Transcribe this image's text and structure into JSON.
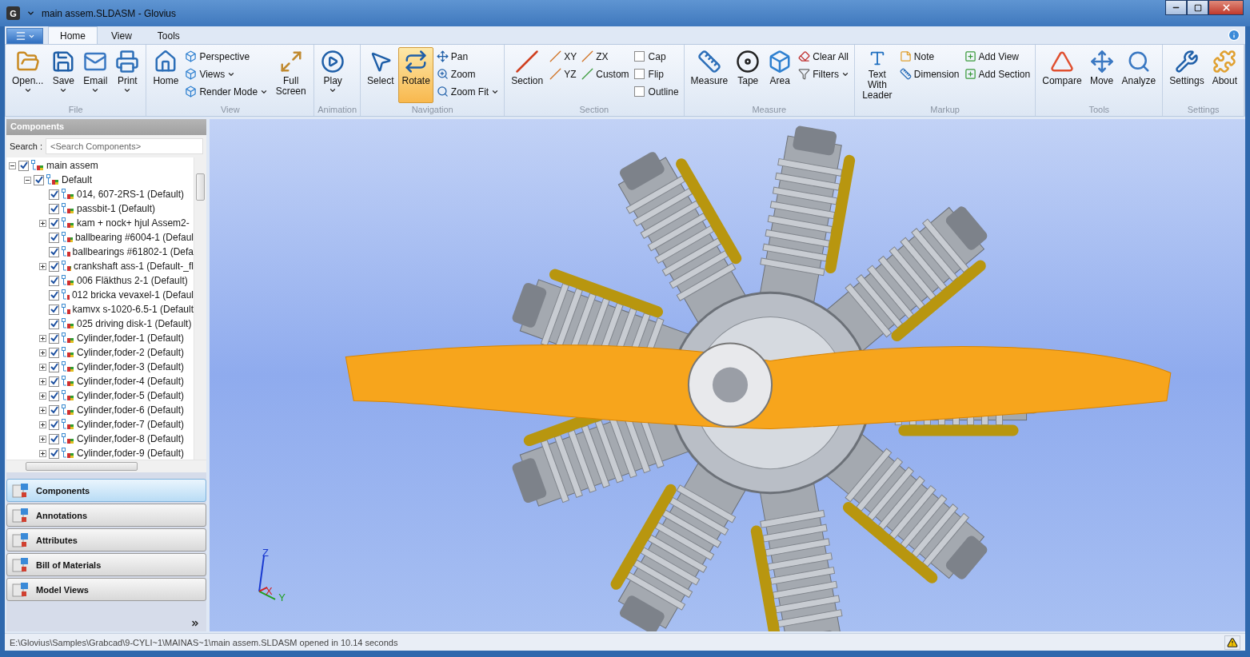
{
  "window": {
    "app_icon_letter": "G",
    "title": "main assem.SLDASM - Glovius"
  },
  "tabs": [
    {
      "label": "Home",
      "selected": true
    },
    {
      "label": "View",
      "selected": false
    },
    {
      "label": "Tools",
      "selected": false
    }
  ],
  "ribbon": [
    {
      "label": "File",
      "items": [
        {
          "kind": "large",
          "label": "Open...",
          "dropdown": true
        },
        {
          "kind": "large",
          "label": "Save",
          "dropdown": true
        },
        {
          "kind": "large",
          "label": "Email",
          "dropdown": true
        },
        {
          "kind": "large",
          "label": "Print",
          "dropdown": true
        }
      ]
    },
    {
      "label": "View",
      "items": [
        {
          "kind": "large",
          "label": "Home"
        },
        {
          "kind": "stack",
          "items": [
            {
              "kind": "small",
              "label": "Perspective"
            },
            {
              "kind": "small",
              "label": "Views",
              "dropdown": true
            },
            {
              "kind": "small",
              "label": "Render Mode",
              "dropdown": true
            }
          ]
        },
        {
          "kind": "large",
          "label": "Full Screen"
        }
      ]
    },
    {
      "label": "Animation",
      "items": [
        {
          "kind": "large",
          "label": "Play",
          "dropdown": true
        }
      ]
    },
    {
      "label": "Navigation",
      "items": [
        {
          "kind": "large",
          "label": "Select",
          "selected": false
        },
        {
          "kind": "large",
          "label": "Rotate",
          "selected": true
        },
        {
          "kind": "stack",
          "items": [
            {
              "kind": "small",
              "label": "Pan"
            },
            {
              "kind": "small",
              "label": "Zoom"
            },
            {
              "kind": "small",
              "label": "Zoom Fit",
              "dropdown": true
            }
          ]
        }
      ]
    },
    {
      "label": "Section",
      "items": [
        {
          "kind": "large",
          "label": "Section"
        },
        {
          "kind": "stack",
          "items": [
            {
              "kind": "small",
              "label": "XY"
            },
            {
              "kind": "small",
              "label": "YZ"
            }
          ]
        },
        {
          "kind": "stack",
          "items": [
            {
              "kind": "small",
              "label": "ZX"
            },
            {
              "kind": "small",
              "label": "Custom"
            }
          ]
        },
        {
          "kind": "stack",
          "items": [
            {
              "kind": "check",
              "label": "Cap",
              "checked": false
            },
            {
              "kind": "check",
              "label": "Flip",
              "checked": false
            },
            {
              "kind": "check",
              "label": "Outline",
              "checked": false
            }
          ]
        }
      ]
    },
    {
      "label": "Measure",
      "items": [
        {
          "kind": "large",
          "label": "Measure"
        },
        {
          "kind": "large",
          "label": "Tape"
        },
        {
          "kind": "large",
          "label": "Area"
        },
        {
          "kind": "stack",
          "items": [
            {
              "kind": "small",
              "label": "Clear All"
            },
            {
              "kind": "small",
              "label": "Filters",
              "dropdown": true
            }
          ]
        }
      ]
    },
    {
      "label": "Markup",
      "items": [
        {
          "kind": "large",
          "label": "Text With Leader"
        },
        {
          "kind": "stack",
          "items": [
            {
              "kind": "small",
              "label": "Note"
            },
            {
              "kind": "small",
              "label": "Dimension"
            }
          ]
        },
        {
          "kind": "stack",
          "items": [
            {
              "kind": "small",
              "label": "Add View"
            },
            {
              "kind": "small",
              "label": "Add Section"
            }
          ]
        }
      ]
    },
    {
      "label": "Tools",
      "items": [
        {
          "kind": "large",
          "label": "Compare"
        },
        {
          "kind": "large",
          "label": "Move"
        },
        {
          "kind": "large",
          "label": "Analyze"
        }
      ]
    },
    {
      "label": "Settings",
      "items": [
        {
          "kind": "large",
          "label": "Settings"
        },
        {
          "kind": "large",
          "label": "About"
        }
      ]
    }
  ],
  "sidebar": {
    "title": "Components",
    "search_label": "Search :",
    "search_placeholder": "<Search Components>",
    "tree": [
      {
        "label": "main assem",
        "checked": true,
        "expanded": true,
        "children": [
          {
            "label": "Default",
            "checked": true,
            "expanded": true,
            "children": [
              {
                "label": "014, 607-2RS-1 (Default)",
                "checked": true
              },
              {
                "label": "passbit-1 (Default)",
                "checked": true
              },
              {
                "label": "kam + nock+  hjul Assem2-",
                "checked": true,
                "expanded": false
              },
              {
                "label": "ballbearing #6004-1 (Defaul",
                "checked": true
              },
              {
                "label": "ballbearings #61802-1 (Defa",
                "checked": true
              },
              {
                "label": "crankshaft ass-1 (Default-_fl",
                "checked": true,
                "expanded": false
              },
              {
                "label": "006 Fläkthus 2-1 (Default)",
                "checked": true
              },
              {
                "label": "012 bricka vevaxel-1 (Defaul",
                "checked": true
              },
              {
                "label": "kamvx s-1020-6.5-1 (Default",
                "checked": true
              },
              {
                "label": "025 driving disk-1 (Default)",
                "checked": true
              },
              {
                "label": "Cylinder,foder-1 (Default)",
                "checked": true,
                "expanded": false
              },
              {
                "label": "Cylinder,foder-2 (Default)",
                "checked": true,
                "expanded": false
              },
              {
                "label": "Cylinder,foder-3 (Default)",
                "checked": true,
                "expanded": false
              },
              {
                "label": "Cylinder,foder-4 (Default)",
                "checked": true,
                "expanded": false
              },
              {
                "label": "Cylinder,foder-5 (Default)",
                "checked": true,
                "expanded": false
              },
              {
                "label": "Cylinder,foder-6 (Default)",
                "checked": true,
                "expanded": false
              },
              {
                "label": "Cylinder,foder-7 (Default)",
                "checked": true,
                "expanded": false
              },
              {
                "label": "Cylinder,foder-8 (Default)",
                "checked": true,
                "expanded": false
              },
              {
                "label": "Cylinder,foder-9 (Default)",
                "checked": true,
                "expanded": false
              }
            ]
          }
        ]
      }
    ],
    "panes": [
      {
        "label": "Components",
        "selected": true
      },
      {
        "label": "Annotations",
        "selected": false
      },
      {
        "label": "Attributes",
        "selected": false
      },
      {
        "label": "Bill of Materials",
        "selected": false
      },
      {
        "label": "Model Views",
        "selected": false
      }
    ]
  },
  "viewport": {
    "axes": {
      "x": "X",
      "y": "Y",
      "z": "Z"
    }
  },
  "status_bar": {
    "text": "E:\\Glovius\\Samples\\Grabcad\\9-CYLI~1\\MAINAS~1\\main assem.SLDASM opened in 10.14 seconds"
  }
}
